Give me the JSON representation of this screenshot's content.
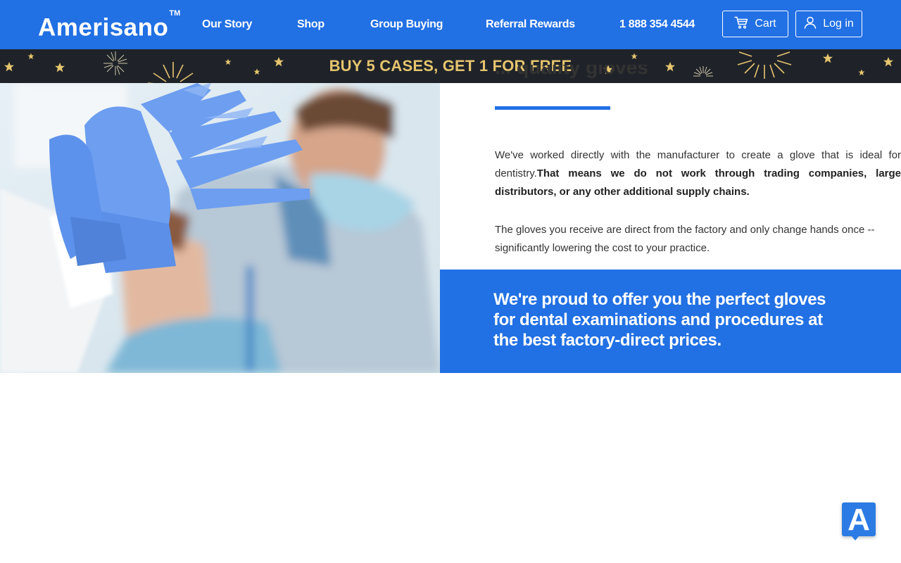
{
  "header": {
    "brand": "Amerisano",
    "trademark": "TM",
    "nav": [
      {
        "label": "Our Story"
      },
      {
        "label": "Shop"
      },
      {
        "label": "Group Buying"
      },
      {
        "label": "Referral Rewards"
      },
      {
        "label": "1 888 354 4544"
      }
    ],
    "cart_label": "Cart",
    "cart_icon": "cart-icon",
    "login_label": "Log in",
    "login_icon": "user-icon"
  },
  "promo": {
    "text": "BUY 5 CASES, GET 1 FOR FREE"
  },
  "content": {
    "heading_partial": "... quality gloves",
    "para1_regular": "We've worked directly with the manufacturer to create a glove that is ideal for dentistry.",
    "para1_bold": "That means we do not work through trading companies, large distributors, or any other additional supply chains.",
    "para2": "The gloves you receive are direct from the factory and only change hands once -- significantly lowering the cost to your practice.",
    "tagline": "We're proud to offer you the perfect gloves for dental examinations and procedures at the best factory-direct prices."
  },
  "widget": {
    "letter": "A",
    "icon": "accessibility-widget-icon"
  },
  "colors": {
    "brand_blue": "#2170e4",
    "promo_bg": "#1f2329",
    "promo_gold": "#e6c56e",
    "text": "#333333"
  }
}
